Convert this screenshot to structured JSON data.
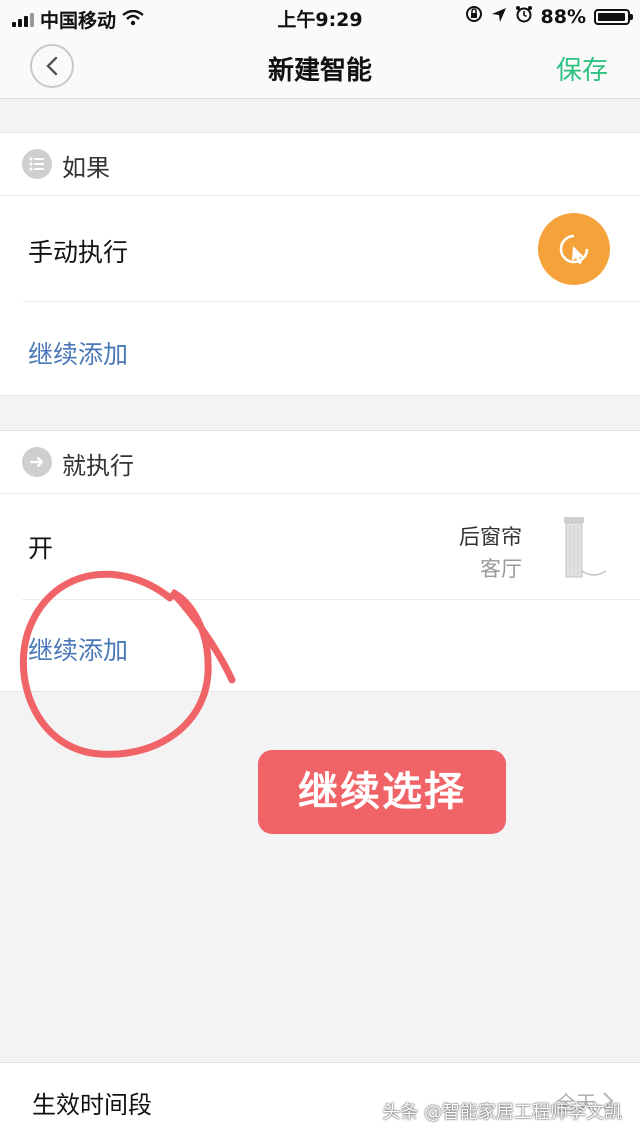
{
  "status_bar": {
    "carrier": "中国移动",
    "time": "上午9:29",
    "battery": "88%",
    "battery_level": 0.88
  },
  "nav": {
    "title": "新建智能",
    "save_label": "保存"
  },
  "if_section": {
    "header": "如果",
    "condition": "手动执行",
    "add_label": "继续添加"
  },
  "then_section": {
    "header": "就执行",
    "action": "开",
    "device_name": "后窗帘",
    "device_room": "客厅",
    "add_label": "继续添加"
  },
  "annotation": {
    "label": "继续选择",
    "color": "#f06468"
  },
  "effective_time": {
    "label": "生效时间段",
    "value": "全天"
  },
  "watermark": "头条 @智能家居工程师李文凯",
  "colors": {
    "accent_green": "#2ec282",
    "link_blue": "#4a78b8",
    "manual_orange": "#f5a23a"
  }
}
